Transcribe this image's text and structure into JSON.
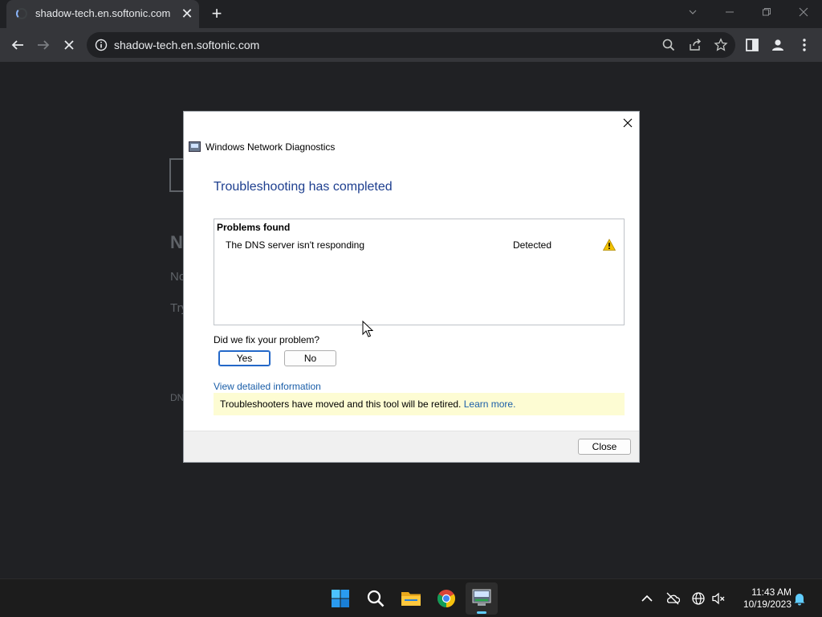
{
  "browser": {
    "tab_title": "shadow-tech.en.softonic.com",
    "tab_close": "✕",
    "new_tab": "+",
    "url": "shadow-tech.en.softonic.com"
  },
  "page": {
    "heading": "N",
    "line1": "No",
    "line2": "Try",
    "code": "DN"
  },
  "dialog": {
    "title": "Windows Network Diagnostics",
    "heading": "Troubleshooting has completed",
    "problems_header": "Problems found",
    "problems": [
      {
        "name": "The DNS server isn't responding",
        "status": "Detected",
        "icon": "warning-icon"
      }
    ],
    "question": "Did we fix your problem?",
    "yes_label": "Yes",
    "no_label": "No",
    "detail_link": "View detailed information",
    "banner_text": "Troubleshooters have moved and this tool will be retired.",
    "banner_link": "Learn more.",
    "close_label": "Close"
  },
  "taskbar": {
    "apps": [
      "start-icon",
      "search-icon",
      "file-explorer-icon",
      "chrome-icon",
      "network-diagnostics-icon"
    ],
    "time": "11:43 AM",
    "date": "10/19/2023"
  },
  "colors": {
    "accent": "#1e3f8f",
    "link": "#1a5ea8",
    "banner": "#fdfcd3",
    "warning": "#f2c200",
    "windows_blue": "#60cdff"
  }
}
